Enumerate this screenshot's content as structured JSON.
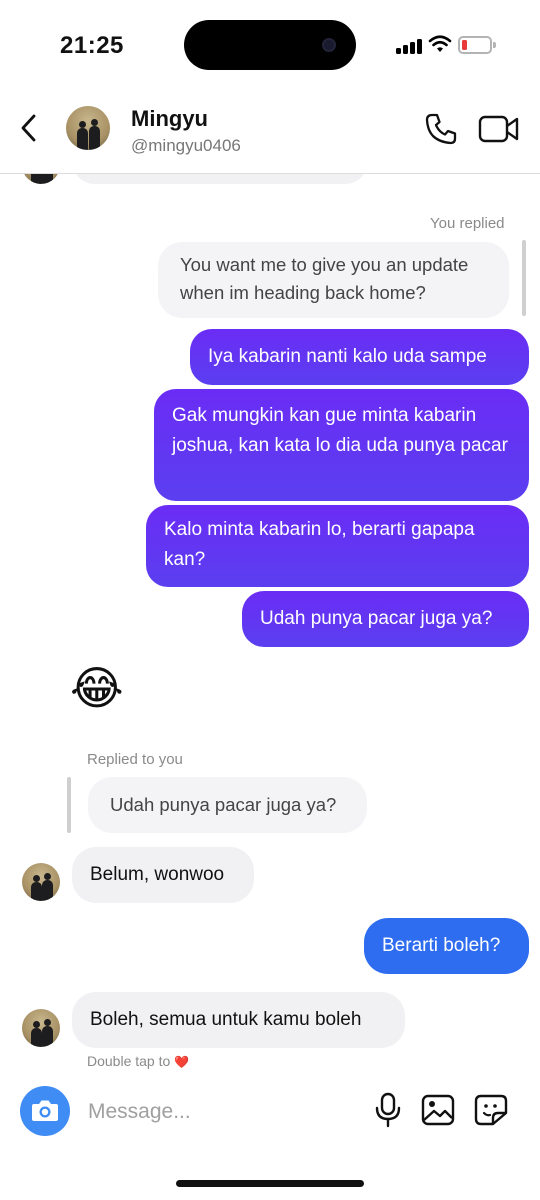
{
  "status_bar": {
    "time": "21:25"
  },
  "header": {
    "name": "Mingyu",
    "handle": "@mingyu0406"
  },
  "chat": {
    "you_replied_label": "You replied",
    "reply_quote": "You want me to give you an update when im heading back home?",
    "sent_messages": [
      "Iya kabarin nanti kalo uda sampe",
      "Gak mungkin kan gue minta kabarin joshua, kan kata lo dia uda punya pacar",
      "Kalo minta kabarin lo, berarti gapapa kan?",
      "Udah punya pacar juga ya?"
    ],
    "emoji_message": "😂",
    "replied_to_you_label": "Replied to you",
    "replied_quote": "Udah punya pacar juga ya?",
    "received_1": "Belum, wonwoo",
    "sent_blue": "Berarti boleh?",
    "received_2": "Boleh, semua untuk kamu boleh",
    "double_tap_label": "Double tap to",
    "double_tap_heart": "❤️"
  },
  "composer": {
    "placeholder": "Message..."
  },
  "icons": [
    "back-icon",
    "call-icon",
    "video-icon",
    "camera-icon",
    "mic-icon",
    "gallery-icon",
    "sticker-icon"
  ],
  "colors": {
    "sent_gradient_top": "#6b2cf5",
    "sent_gradient_bottom": "#5a3ff0",
    "sent_blue": "#2e6cf0",
    "received_bg": "#f1f1f3",
    "camera_button": "#3f8cf5"
  }
}
